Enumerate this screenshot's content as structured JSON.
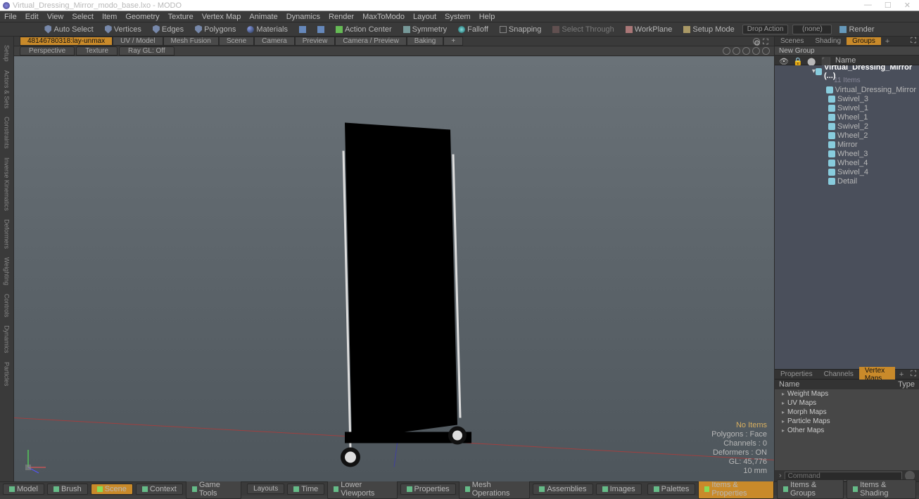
{
  "title": "Virtual_Dressing_Mirror_modo_base.lxo - MODO",
  "winctrls": {
    "min": "—",
    "max": "☐",
    "close": "✕"
  },
  "menu": [
    "File",
    "Edit",
    "View",
    "Select",
    "Item",
    "Geometry",
    "Texture",
    "Vertex Map",
    "Animate",
    "Dynamics",
    "Render",
    "MaxToModo",
    "Layout",
    "System",
    "Help"
  ],
  "toolbar": {
    "autoselect": "Auto Select",
    "vertices": "Vertices",
    "edges": "Edges",
    "polygons": "Polygons",
    "materials": "Materials",
    "actioncenter": "Action Center",
    "symmetry": "Symmetry",
    "falloff": "Falloff",
    "snapping": "Snapping",
    "selectthrough": "Select Through",
    "workplane": "WorkPlane",
    "setupmode": "Setup Mode",
    "dropaction": "Drop Action",
    "none": "(none)",
    "render": "Render"
  },
  "vptabs": {
    "active": "48146780318:lay-unmax",
    "tabs": [
      "UV / Model",
      "Mesh Fusion",
      "Scene",
      "Camera",
      "Preview",
      "Camera / Preview",
      "Baking"
    ]
  },
  "subtabs": {
    "persp": "Perspective",
    "texture": "Texture",
    "raygl": "Ray GL: Off"
  },
  "overlay": {
    "noitems": "No Items",
    "polys": "Polygons : Face",
    "channels": "Channels : 0",
    "deformers": "Deformers : ON",
    "gl": "GL: 45,776",
    "unit": "10 mm"
  },
  "scene_tabs": {
    "scenes": "Scenes",
    "shading": "Shading",
    "groups": "Groups"
  },
  "newgroup": "New Group",
  "tree_head": {
    "name": "Name"
  },
  "tree": {
    "root": "Virtual_Dressing_Mirror (...)",
    "count": "11 Items",
    "items": [
      "Virtual_Dressing_Mirror",
      "Swivel_3",
      "Swivel_1",
      "Wheel_1",
      "Swivel_2",
      "Wheel_2",
      "Mirror",
      "Wheel_3",
      "Wheel_4",
      "Swivel_4",
      "Detail"
    ]
  },
  "prop_tabs": {
    "properties": "Properties",
    "channels": "Channels",
    "vertexmaps": "Vertex Maps"
  },
  "prop_head": {
    "name": "Name",
    "type": "Type"
  },
  "prop_list": [
    "Weight Maps",
    "UV Maps",
    "Morph Maps",
    "Particle Maps",
    "Other Maps"
  ],
  "cmd_placeholder": "Command",
  "bottom_left": [
    "Model",
    "Brush",
    "Scene",
    "Context",
    "Game Tools"
  ],
  "bottom_mid": [
    "Layouts",
    "Time",
    "Lower Viewports",
    "Properties",
    "Mesh Operations",
    "Assemblies",
    "Images"
  ],
  "bottom_right": [
    "Palettes",
    "Items & Properties",
    "Items & Groups",
    "Items & Shading"
  ]
}
